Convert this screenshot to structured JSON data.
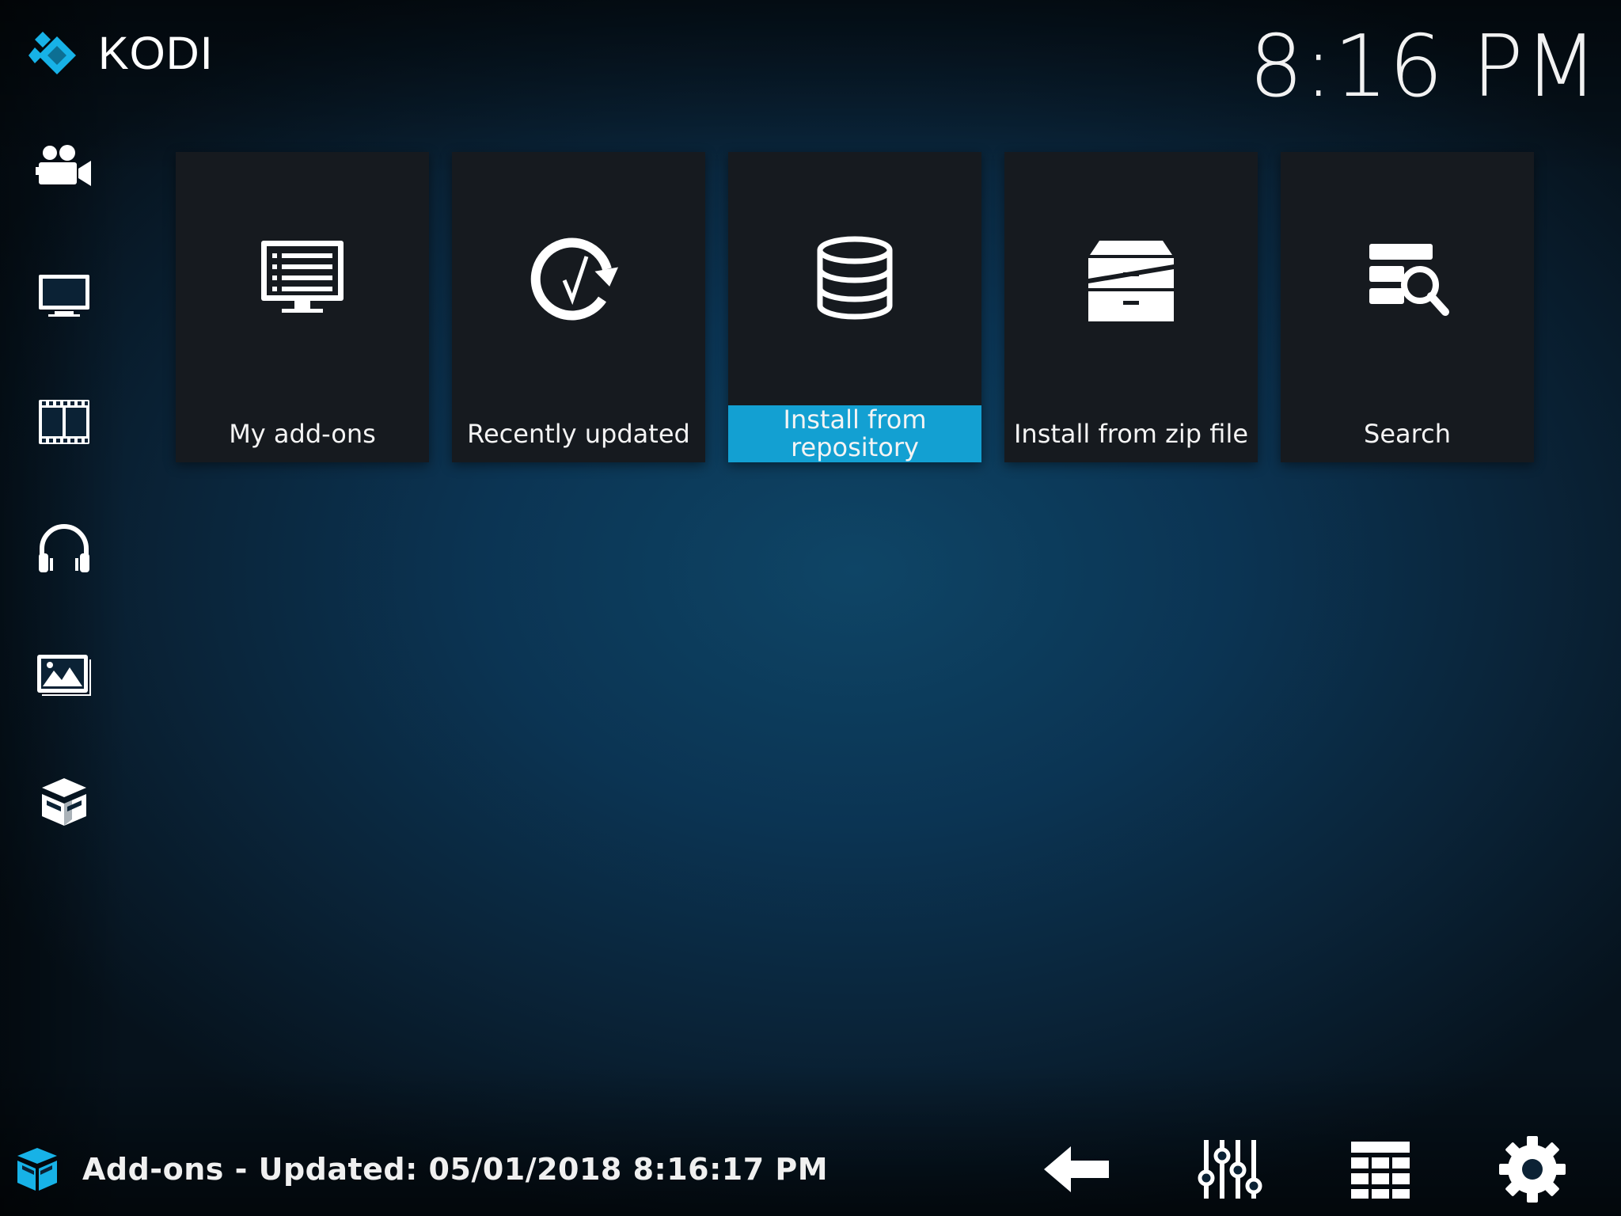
{
  "app": {
    "logo_text": "KODI",
    "clock": "8:16 PM"
  },
  "sidebar": {
    "items": [
      {
        "icon": "camera-icon",
        "name": "movies"
      },
      {
        "icon": "tv-icon",
        "name": "tv-shows"
      },
      {
        "icon": "film-icon",
        "name": "videos"
      },
      {
        "icon": "headphones-icon",
        "name": "music"
      },
      {
        "icon": "pictures-icon",
        "name": "pictures"
      },
      {
        "icon": "addons-box-icon",
        "name": "add-ons"
      }
    ]
  },
  "tiles": [
    {
      "label": "My add-ons",
      "icon": "monitor-list-icon",
      "focused": false
    },
    {
      "label": "Recently updated",
      "icon": "refresh-check-icon",
      "focused": false
    },
    {
      "label": "Install from repository",
      "icon": "database-icon",
      "focused": true
    },
    {
      "label": "Install from zip file",
      "icon": "archive-drawer-icon",
      "focused": false
    },
    {
      "label": "Search",
      "icon": "search-list-icon",
      "focused": false
    }
  ],
  "footer": {
    "status_text": "Add-ons - Updated: 05/01/2018 8:16:17 PM",
    "buttons": [
      {
        "icon": "back-arrow-icon"
      },
      {
        "icon": "sliders-icon"
      },
      {
        "icon": "grid-view-icon"
      },
      {
        "icon": "gear-icon"
      }
    ]
  },
  "colors": {
    "accent": "#13a0d2",
    "tile_bg": "#161a1f",
    "background": "#0b3453"
  }
}
